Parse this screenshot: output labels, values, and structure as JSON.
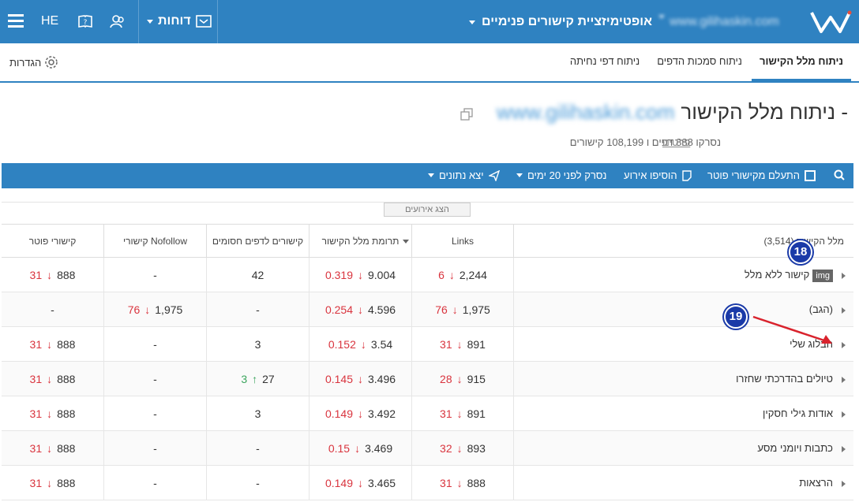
{
  "topbar": {
    "lang": "HE",
    "reports_label": "דוחות",
    "project_name": "אופטימיזציית קישורים פנימיים",
    "domain": "www.gilihaskin.com"
  },
  "tabs": [
    {
      "label": "ניתוח מלל הקישור",
      "active": true
    },
    {
      "label": "ניתוח סמכות הדפים",
      "active": false
    },
    {
      "label": "ניתוח דפי נחיתה",
      "active": false
    }
  ],
  "settings_label": "הגדרות",
  "page": {
    "title": "ניתוח מלל הקישור -",
    "domain": "www.gilihaskin.com",
    "subtitle": "נסרקו 888 דפים ו 108,199 קישורים",
    "details_link": "פרטים"
  },
  "toolbar": {
    "ignore_footer": "התעלם מקישורי פוטר",
    "add_event": "הוסיפו אירוע",
    "scanned": "נסרק לפני 20 ימים",
    "export": "יצא נתונים"
  },
  "events_button": "הצג אירועים",
  "table": {
    "headers": {
      "anchor": "מלל הקישור (3,514)",
      "links": "Links",
      "contribution": "תרומת מלל הקישור",
      "blocked": "קישורים לדפים חסומים",
      "nofollow": "קישורי Nofollow",
      "footer": "קישורי פוטר"
    },
    "rows": [
      {
        "anchor": "קישור ללא מלל",
        "img": "img",
        "links": "2,244",
        "links_delta": "6",
        "contrib": "9.004",
        "contrib_delta": "0.319",
        "blocked": "42",
        "blocked_delta": "",
        "nofollow": "-",
        "nofollow_delta": "",
        "footer": "888",
        "footer_delta": "31"
      },
      {
        "anchor": "(הגב)",
        "img": "",
        "links": "1,975",
        "links_delta": "76",
        "contrib": "4.596",
        "contrib_delta": "0.254",
        "blocked": "-",
        "blocked_delta": "",
        "nofollow": "1,975",
        "nofollow_delta": "76",
        "footer": "-",
        "footer_delta": ""
      },
      {
        "anchor": "הבלוג שלי",
        "img": "",
        "links": "891",
        "links_delta": "31",
        "contrib": "3.54",
        "contrib_delta": "0.152",
        "blocked": "3",
        "blocked_delta": "",
        "nofollow": "-",
        "nofollow_delta": "",
        "footer": "888",
        "footer_delta": "31"
      },
      {
        "anchor": "טיולים בהדרכתי שחזרו",
        "img": "",
        "links": "915",
        "links_delta": "28",
        "contrib": "3.496",
        "contrib_delta": "0.145",
        "blocked": "27",
        "blocked_delta": "3",
        "nofollow": "-",
        "nofollow_delta": "",
        "footer": "888",
        "footer_delta": "31"
      },
      {
        "anchor": "אודות גילי חסקין",
        "img": "",
        "links": "891",
        "links_delta": "31",
        "contrib": "3.492",
        "contrib_delta": "0.149",
        "blocked": "3",
        "blocked_delta": "",
        "nofollow": "-",
        "nofollow_delta": "",
        "footer": "888",
        "footer_delta": "31"
      },
      {
        "anchor": "כתבות ויומני מסע",
        "img": "",
        "links": "893",
        "links_delta": "32",
        "contrib": "3.469",
        "contrib_delta": "0.15",
        "blocked": "-",
        "blocked_delta": "",
        "nofollow": "-",
        "nofollow_delta": "",
        "footer": "888",
        "footer_delta": "31"
      },
      {
        "anchor": "הרצאות",
        "img": "",
        "links": "888",
        "links_delta": "31",
        "contrib": "3.465",
        "contrib_delta": "0.149",
        "blocked": "-",
        "blocked_delta": "",
        "nofollow": "-",
        "nofollow_delta": "",
        "footer": "888",
        "footer_delta": "31"
      }
    ]
  },
  "annotations": {
    "badge_a": "18",
    "badge_b": "19"
  },
  "colors": {
    "primary": "#2f82c1",
    "down": "#d9343e",
    "up": "#3ba55d",
    "annotation": "#1a3aa8"
  }
}
